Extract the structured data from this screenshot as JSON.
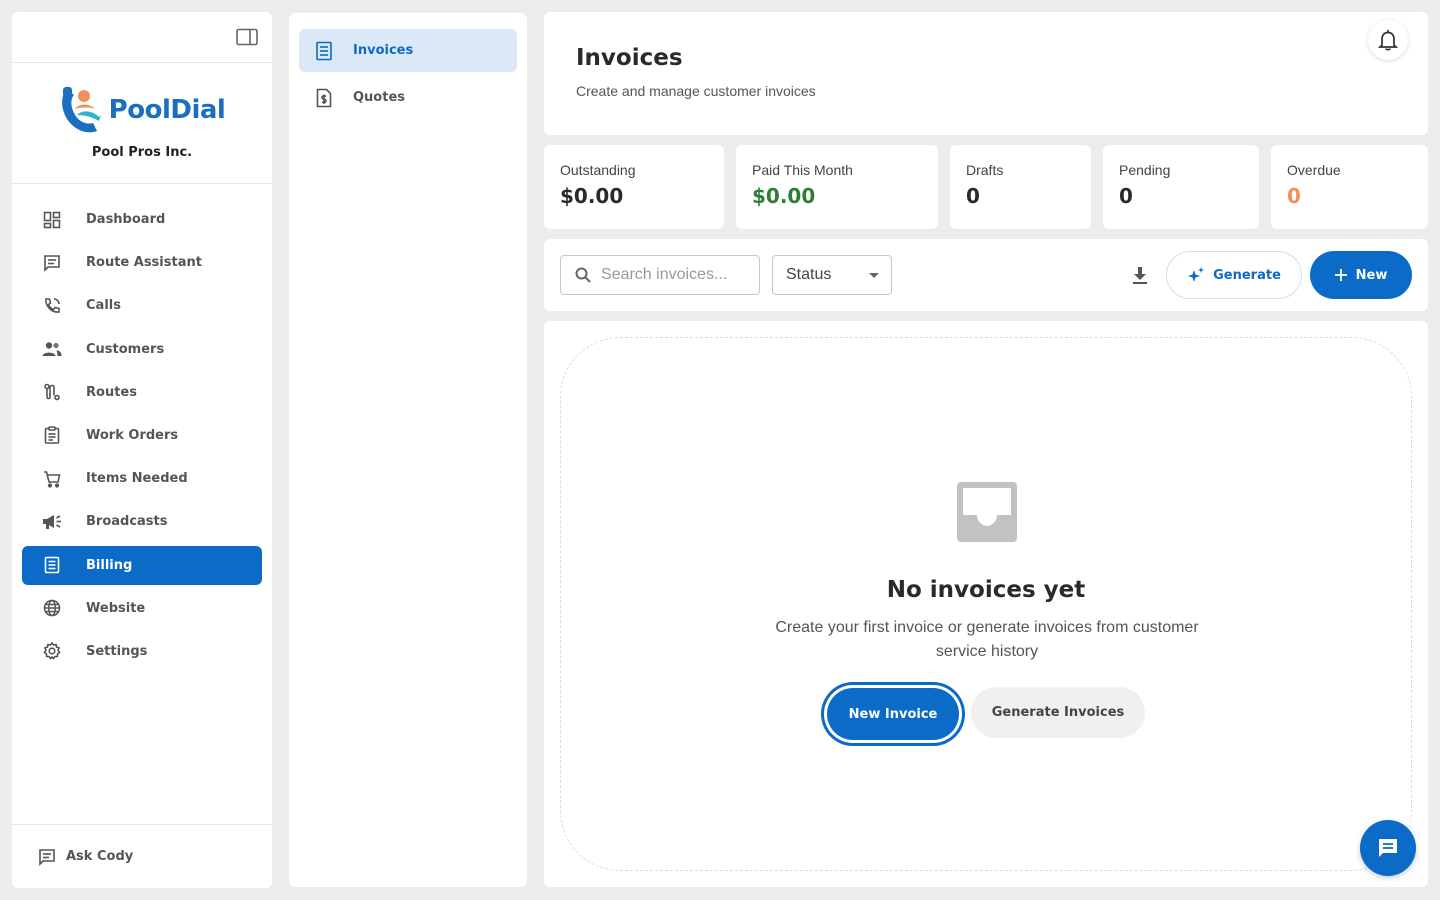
{
  "brand": {
    "logo_text": "PoolDial",
    "company": "Pool Pros Inc."
  },
  "sidebar": {
    "items": [
      {
        "label": "Dashboard",
        "icon": "dashboard-icon"
      },
      {
        "label": "Route Assistant",
        "icon": "chat-icon"
      },
      {
        "label": "Calls",
        "icon": "phone-icon"
      },
      {
        "label": "Customers",
        "icon": "people-icon"
      },
      {
        "label": "Routes",
        "icon": "route-icon"
      },
      {
        "label": "Work Orders",
        "icon": "clipboard-icon"
      },
      {
        "label": "Items Needed",
        "icon": "cart-icon"
      },
      {
        "label": "Broadcasts",
        "icon": "megaphone-icon"
      },
      {
        "label": "Billing",
        "icon": "receipt-icon",
        "active": true
      },
      {
        "label": "Website",
        "icon": "globe-icon"
      },
      {
        "label": "Settings",
        "icon": "gear-icon"
      }
    ],
    "bottom_label": "Ask Cody"
  },
  "subnav": {
    "items": [
      {
        "label": "Invoices",
        "icon": "receipt-icon",
        "active": true
      },
      {
        "label": "Quotes",
        "icon": "quote-icon"
      }
    ]
  },
  "header": {
    "title": "Invoices",
    "subtitle": "Create and manage customer invoices"
  },
  "stats": [
    {
      "label": "Outstanding",
      "value": "$0.00",
      "color": "#2a2a2a"
    },
    {
      "label": "Paid This Month",
      "value": "$0.00",
      "color": "#2e7d32"
    },
    {
      "label": "Drafts",
      "value": "0",
      "color": "#2a2a2a"
    },
    {
      "label": "Pending",
      "value": "0",
      "color": "#2a2a2a"
    },
    {
      "label": "Overdue",
      "value": "0",
      "color": "#f0915a"
    }
  ],
  "toolbar": {
    "search_placeholder": "Search invoices...",
    "search_value": "",
    "status_label": "Status",
    "generate_label": "Generate",
    "new_label": "New"
  },
  "empty_state": {
    "title": "No invoices yet",
    "description": "Create your first invoice or generate invoices from customer service history",
    "primary_label": "New Invoice",
    "secondary_label": "Generate Invoices"
  },
  "colors": {
    "accent": "#0b6bc7",
    "accent_light": "#dbe8f6",
    "success": "#2e7d32",
    "warning": "#f0915a"
  }
}
